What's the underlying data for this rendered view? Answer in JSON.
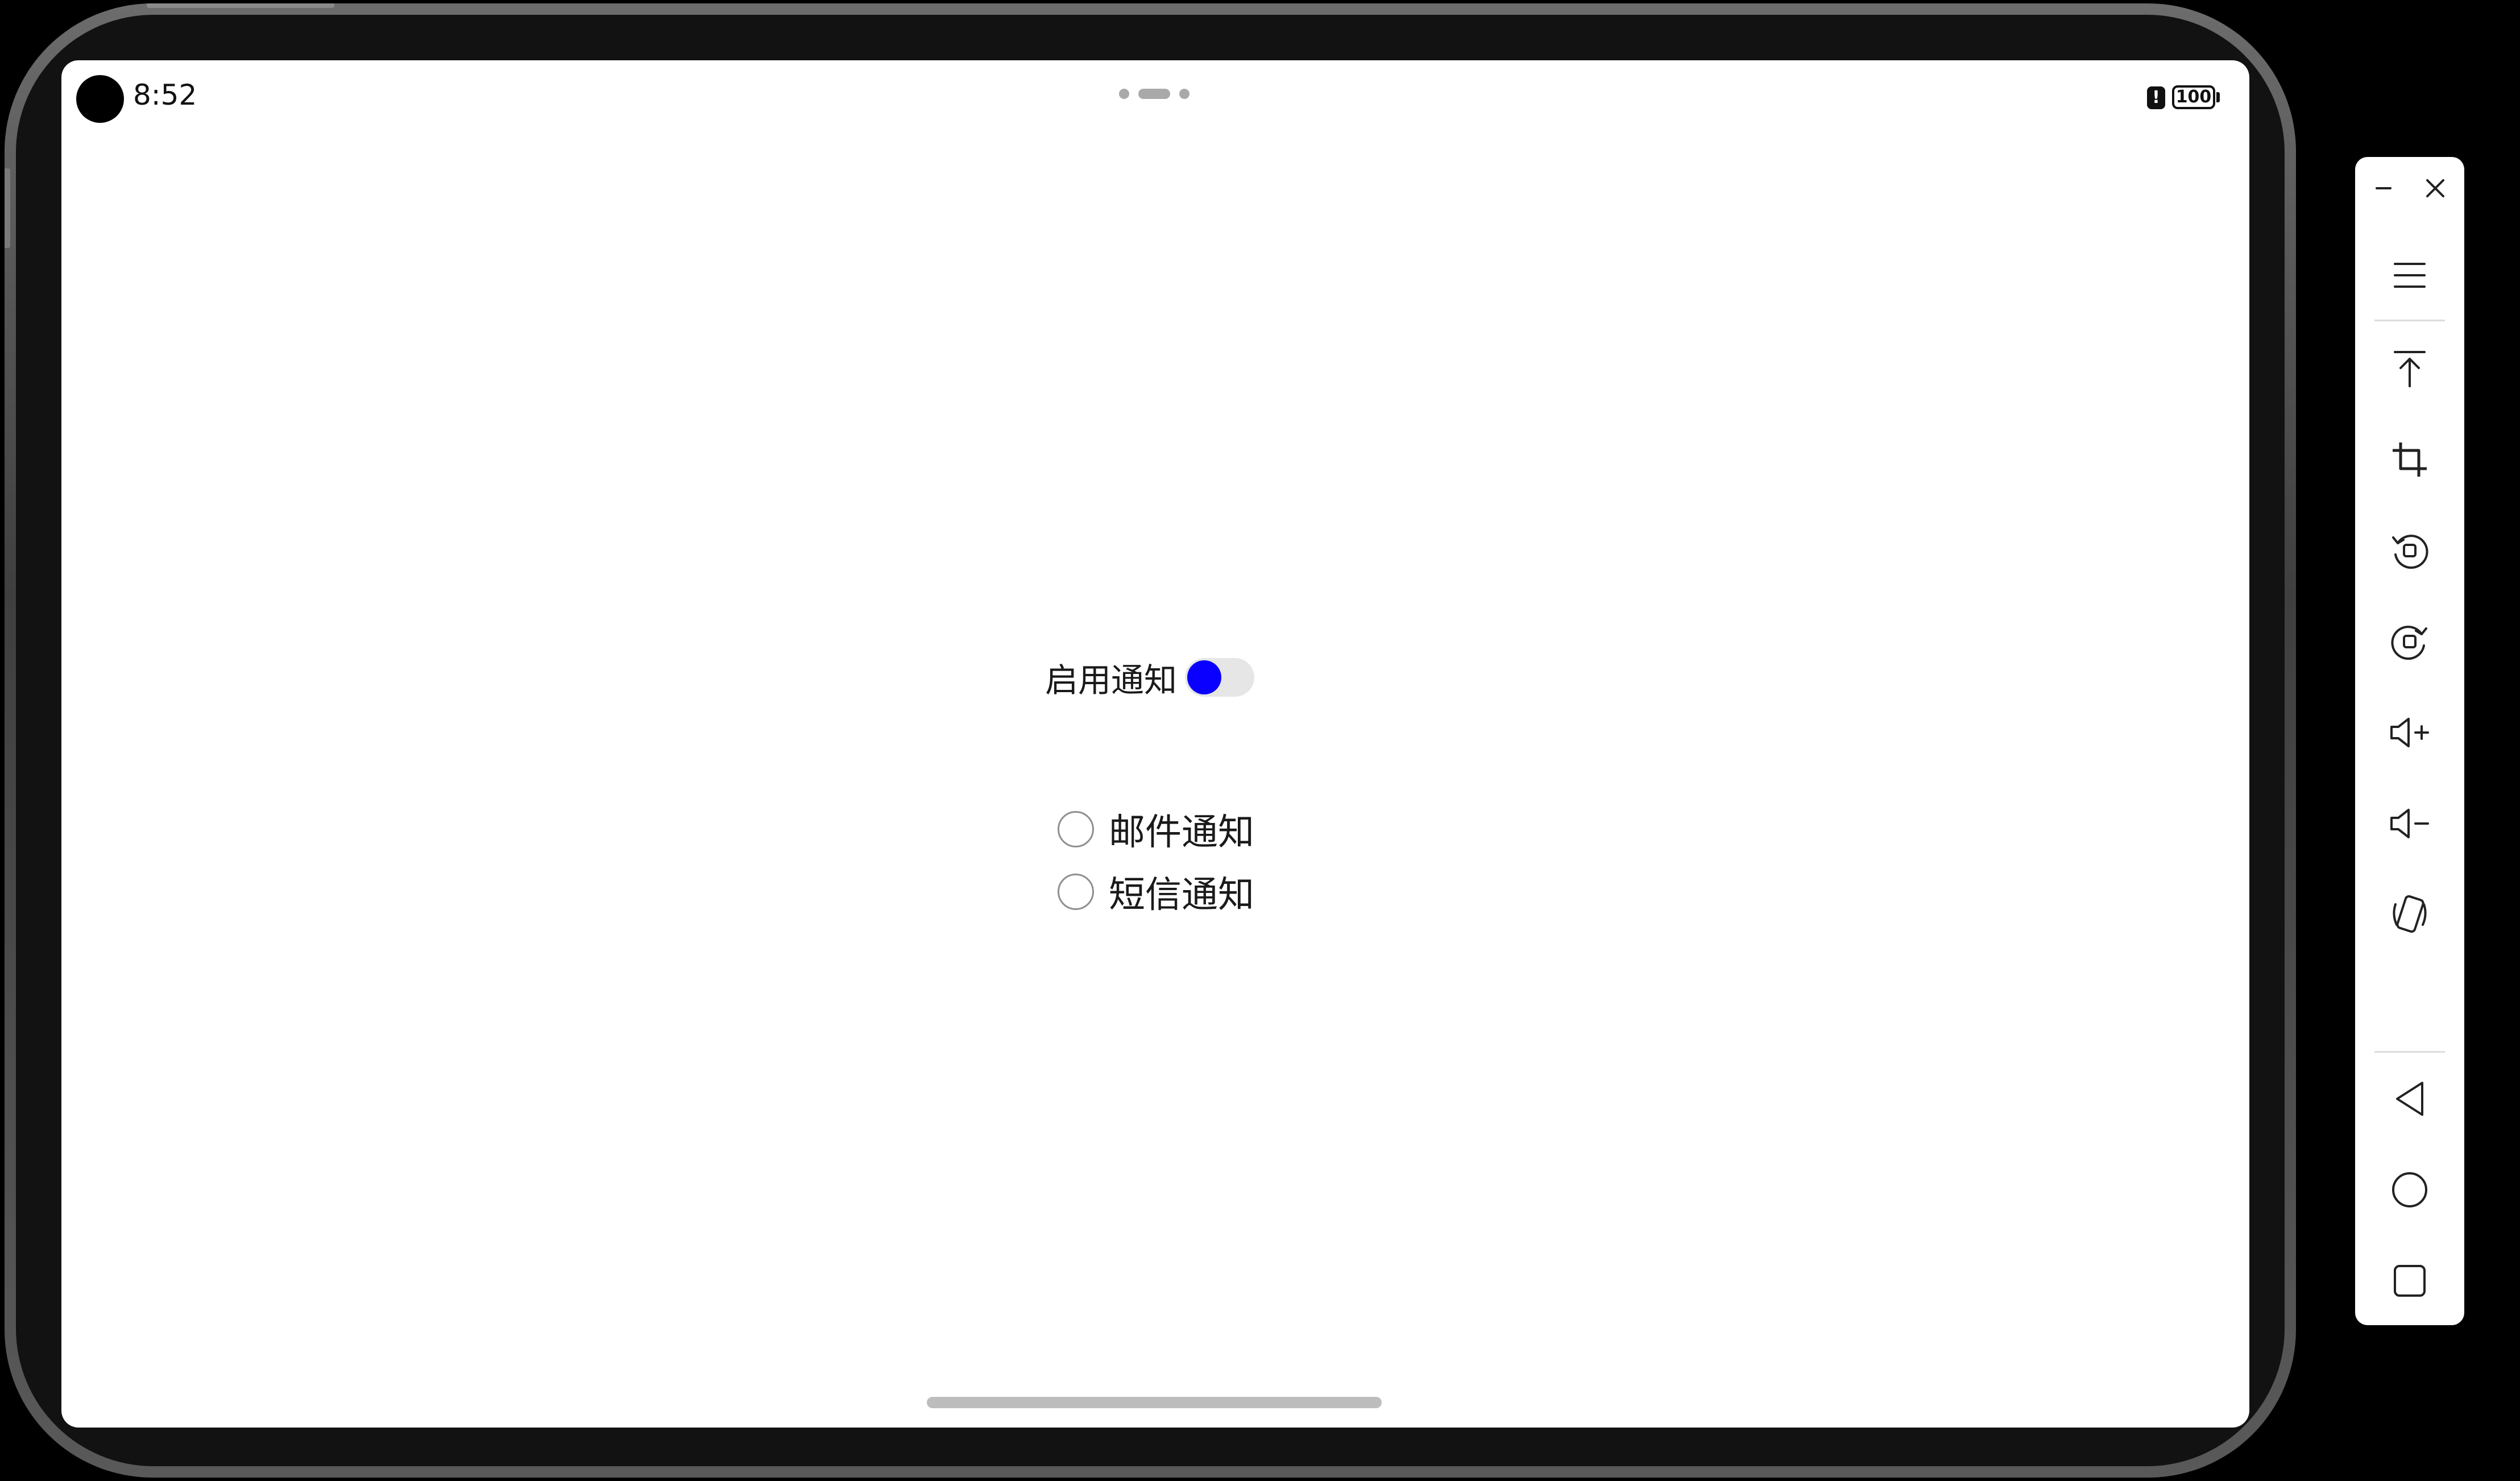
{
  "status_bar": {
    "time": "8:52",
    "alert_glyph": "!",
    "battery_level": "100"
  },
  "content": {
    "toggle_label": "启用通知",
    "toggle_on": true,
    "toggle_color": "#0a00ff",
    "options": [
      {
        "label": "邮件通知",
        "checked": false
      },
      {
        "label": "短信通知",
        "checked": false
      }
    ]
  },
  "toolbar": {
    "buttons": [
      "minimize-icon",
      "close-icon",
      "menu-icon",
      "pin-to-top-icon",
      "crop-screenshot-icon",
      "rotate-left-icon",
      "rotate-right-icon",
      "volume-up-icon",
      "volume-down-icon",
      "shake-icon",
      "back-icon",
      "home-icon",
      "recents-icon"
    ]
  }
}
